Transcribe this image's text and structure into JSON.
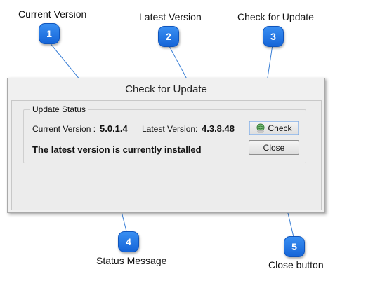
{
  "callouts": [
    {
      "number": "1",
      "label": "Current Version"
    },
    {
      "number": "2",
      "label": "Latest Version"
    },
    {
      "number": "3",
      "label": "Check for Update"
    },
    {
      "number": "4",
      "label": "Status Message"
    },
    {
      "number": "5",
      "label": "Close button"
    }
  ],
  "window": {
    "title": "Check for Update",
    "group_title": "Update Status",
    "current_version_label": "Current Version :",
    "current_version_value": "5.0.1.4",
    "latest_version_label": "Latest Version:",
    "latest_version_value": "4.3.8.48",
    "status_message": "The latest version is currently installed",
    "check_button": "Check",
    "close_button": "Close",
    "check_icon": "update-globe-icon"
  },
  "colors": {
    "badge": "#1f72e0",
    "callout_line": "#3a7fd6",
    "window_bg": "#f0f0f0"
  }
}
